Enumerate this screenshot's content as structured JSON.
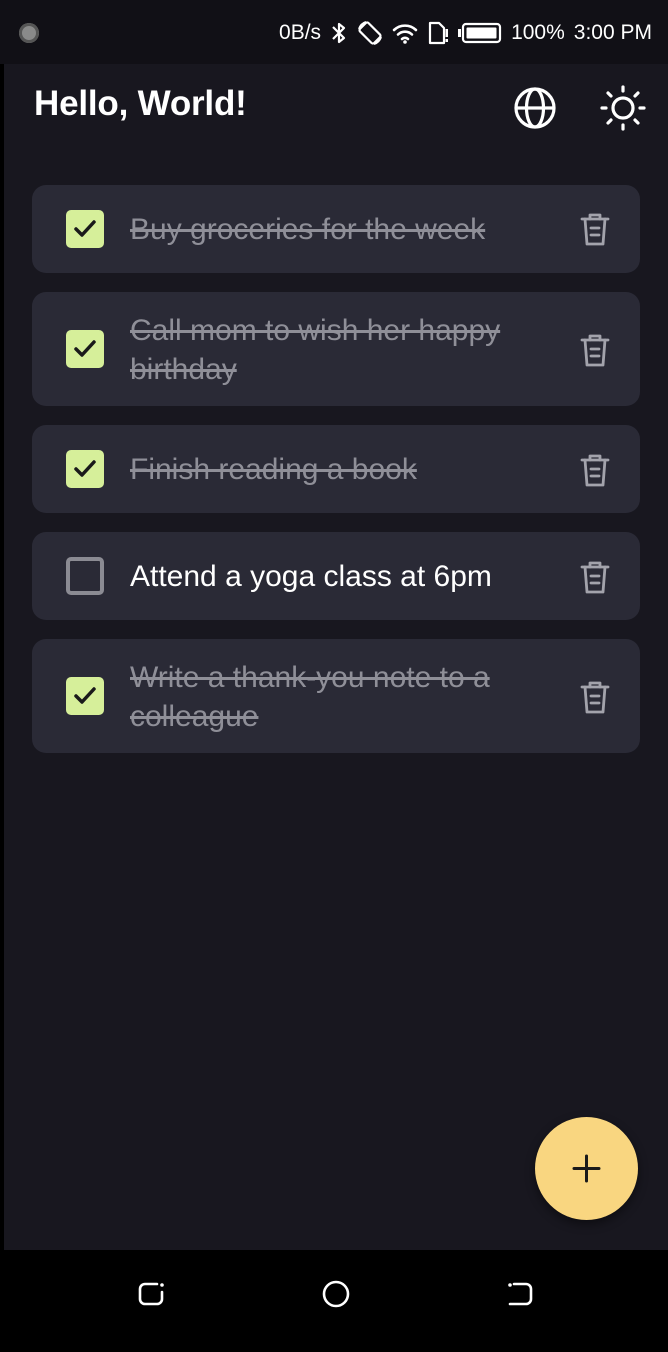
{
  "status_bar": {
    "net_speed": "0B/s",
    "battery": "100%",
    "time": "3:00 PM"
  },
  "header": {
    "title": "Hello, World!",
    "language_icon": "globe-icon",
    "theme_icon": "sun-icon"
  },
  "tasks": [
    {
      "text": "Buy groceries for the week",
      "done": true
    },
    {
      "text": "Call mom to wish her happy birthday",
      "done": true
    },
    {
      "text": "Finish reading a book",
      "done": true
    },
    {
      "text": "Attend a yoga class at 6pm",
      "done": false
    },
    {
      "text": "Write a thank-you note to a colleague",
      "done": true
    }
  ],
  "fab": {
    "icon": "plus-icon"
  },
  "colors": {
    "background": "#18171f",
    "card": "#2a2a36",
    "checkbox_checked": "#d6ef9a",
    "fab": "#f9d680",
    "done_text": "#8f8f98"
  }
}
